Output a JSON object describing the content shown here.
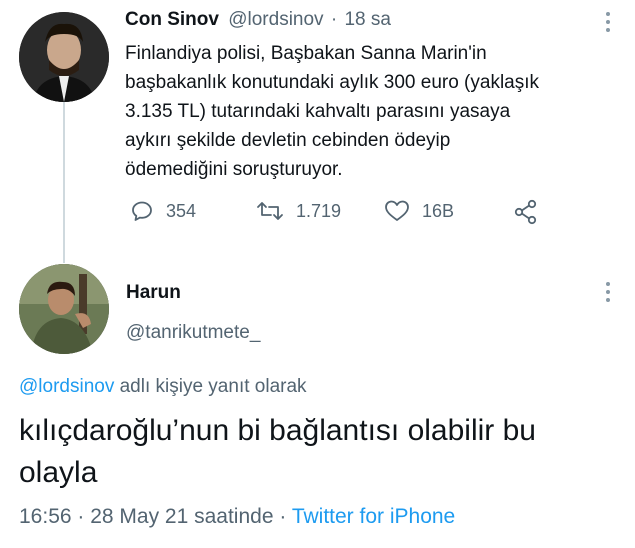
{
  "parent_tweet": {
    "author_name": "Con Sinov",
    "author_handle": "@lordsinov",
    "separator": "·",
    "time_ago": "18 sa",
    "text_lines": [
      "Finlandiya polisi, Başbakan Sanna Marin'in",
      "başbakanlık konutundaki aylık 300 euro (yaklaşık",
      "3.135 TL) tutarındaki kahvaltı parasını yasaya",
      "aykırı şekilde devletin cebinden ödeyip",
      "ödemediğini soruşturuyor."
    ],
    "actions": {
      "reply_count": "354",
      "retweet_count": "1.719",
      "like_count": "16B"
    }
  },
  "reply_tweet": {
    "author_name": "Harun",
    "author_handle": "@tanrikutmete_",
    "reply_to_handle": "@lordsinov",
    "reply_to_suffix": "adlı kişiye yanıt olarak",
    "text_lines": [
      "kılıçdaroğlu’nun bi bağlantısı olabilir bu",
      "olayla"
    ],
    "timestamp": "16:56 · 28 May 21 saatinde",
    "separator": "·",
    "source": "Twitter for iPhone"
  },
  "icons": {
    "reply": "comment-icon",
    "retweet": "retweet-icon",
    "like": "heart-icon",
    "share": "share-icon",
    "more": "more-vertical-icon"
  },
  "colors": {
    "link": "#1d9bf0",
    "muted": "#536471",
    "text": "#0f1419"
  }
}
